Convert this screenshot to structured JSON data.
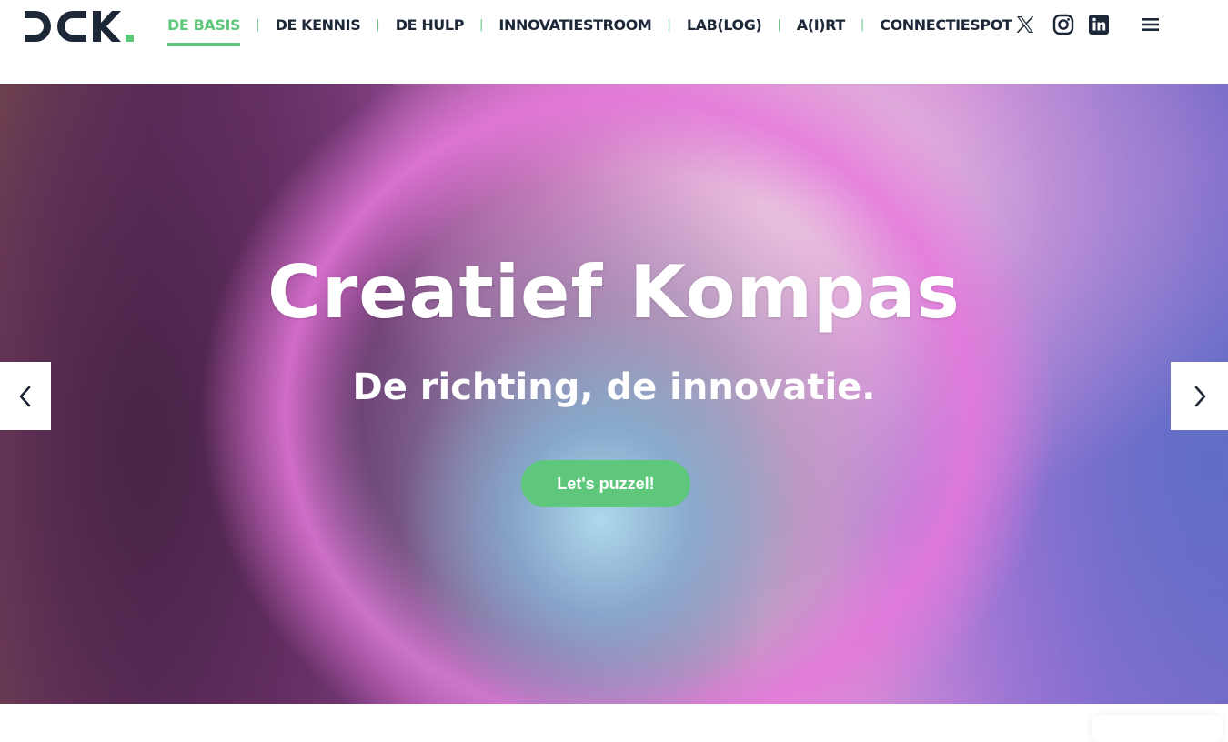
{
  "header": {
    "logo_text": "DCK.",
    "nav": [
      {
        "label": "DE BASIS",
        "active": true
      },
      {
        "label": "DE KENNIS",
        "active": false
      },
      {
        "label": "DE HULP",
        "active": false
      },
      {
        "label": "INNOVATIESTROOM",
        "active": false
      },
      {
        "label": "LAB(LOG)",
        "active": false
      },
      {
        "label": "A(I)RT",
        "active": false
      },
      {
        "label": "CONNECTIESPOT",
        "active": false
      }
    ],
    "separator": "|",
    "social": [
      "x-icon",
      "instagram-icon",
      "linkedin-icon"
    ],
    "menu_icon": "hamburger-menu-icon"
  },
  "hero": {
    "title": "Creatief Kompas",
    "subtitle": "De richting, de innovatie.",
    "cta_label": "Let's puzzel!",
    "prev_icon": "chevron-left-icon",
    "next_icon": "chevron-right-icon"
  },
  "colors": {
    "accent": "#5ec77c",
    "navy": "#1c2738",
    "white": "#ffffff"
  }
}
